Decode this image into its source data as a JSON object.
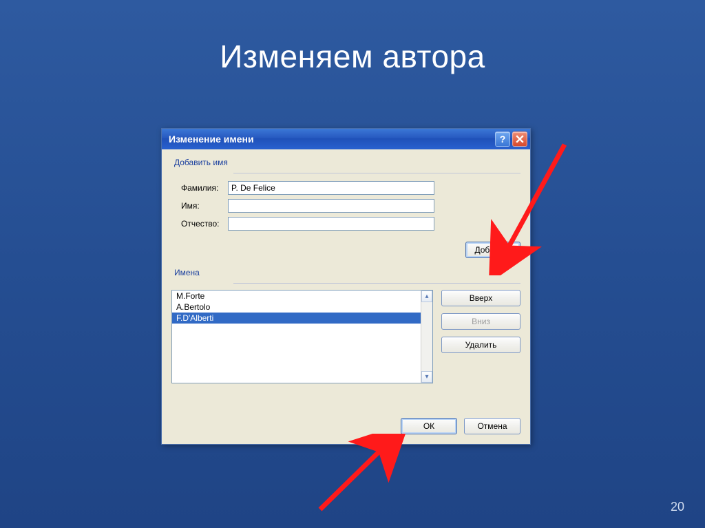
{
  "slide": {
    "title": "Изменяем автора",
    "number": "20"
  },
  "dialog": {
    "title": "Изменение имени",
    "group_add_legend": "Добавить имя",
    "labels": {
      "surname": "Фамилия:",
      "firstname": "Имя:",
      "middlename": "Отчество:"
    },
    "fields": {
      "surname": "P. De Felice",
      "firstname": "",
      "middlename": ""
    },
    "add_button": "Добавить",
    "group_names_legend": "Имена",
    "names": [
      "M.Forte",
      "A.Bertolo",
      "F.D'Alberti"
    ],
    "selected_index": 2,
    "side_buttons": {
      "up": "Вверх",
      "down": "Вниз",
      "delete": "Удалить"
    },
    "actions": {
      "ok": "ОК",
      "cancel": "Отмена"
    }
  }
}
